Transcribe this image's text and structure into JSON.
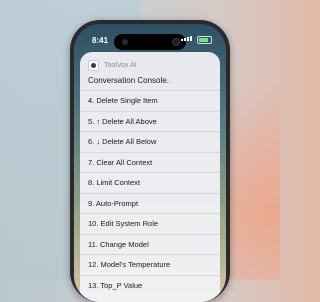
{
  "status": {
    "time": "8:41"
  },
  "app": {
    "name": "ToolVox AI",
    "subtitle": "Conversation Console."
  },
  "menu": [
    "4. Delete Single Item",
    "5. ↑ Delete All Above",
    "6. ↓ Delete All Below",
    "7. Clear All Context",
    "8. Limit Context",
    "9. Auto-Prompt",
    "10. Edit System Role",
    "11. Change Model",
    "12. Model's Temperature",
    "13. Top_P Value"
  ],
  "icons": {
    "signal": "signal-icon",
    "battery": "battery-icon",
    "app": "toolvox-app-icon"
  },
  "colors": {
    "battery_fill": "#7fe07f"
  }
}
